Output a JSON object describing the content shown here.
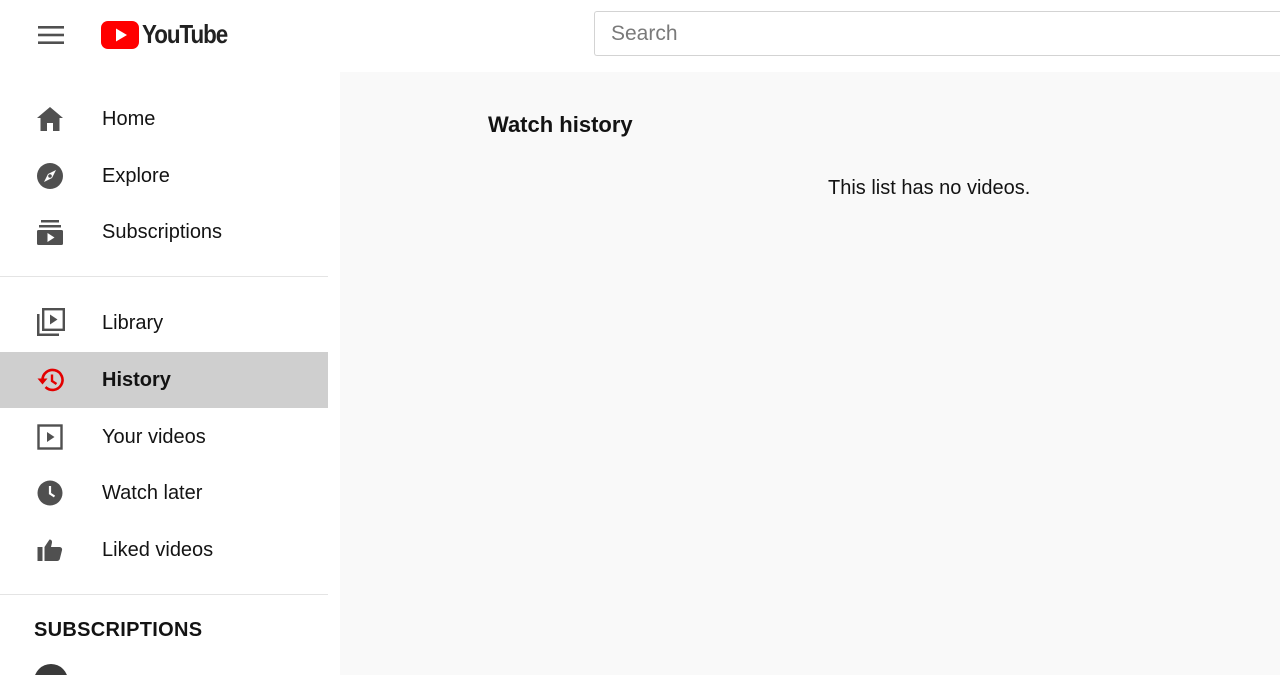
{
  "header": {
    "logo_text": "YouTube",
    "search_placeholder": "Search",
    "brand_color": "#ff0000"
  },
  "sidebar": {
    "primary": [
      {
        "label": "Home",
        "icon": "home-icon"
      },
      {
        "label": "Explore",
        "icon": "compass-icon"
      },
      {
        "label": "Subscriptions",
        "icon": "subscriptions-icon"
      }
    ],
    "secondary": [
      {
        "label": "Library",
        "icon": "library-icon"
      },
      {
        "label": "History",
        "icon": "history-icon",
        "active": true
      },
      {
        "label": "Your videos",
        "icon": "play-square-icon"
      },
      {
        "label": "Watch later",
        "icon": "clock-icon"
      },
      {
        "label": "Liked videos",
        "icon": "thumbs-up-icon"
      }
    ],
    "subscriptions_title": "SUBSCRIPTIONS"
  },
  "main": {
    "title": "Watch history",
    "empty_message": "This list has no videos."
  }
}
